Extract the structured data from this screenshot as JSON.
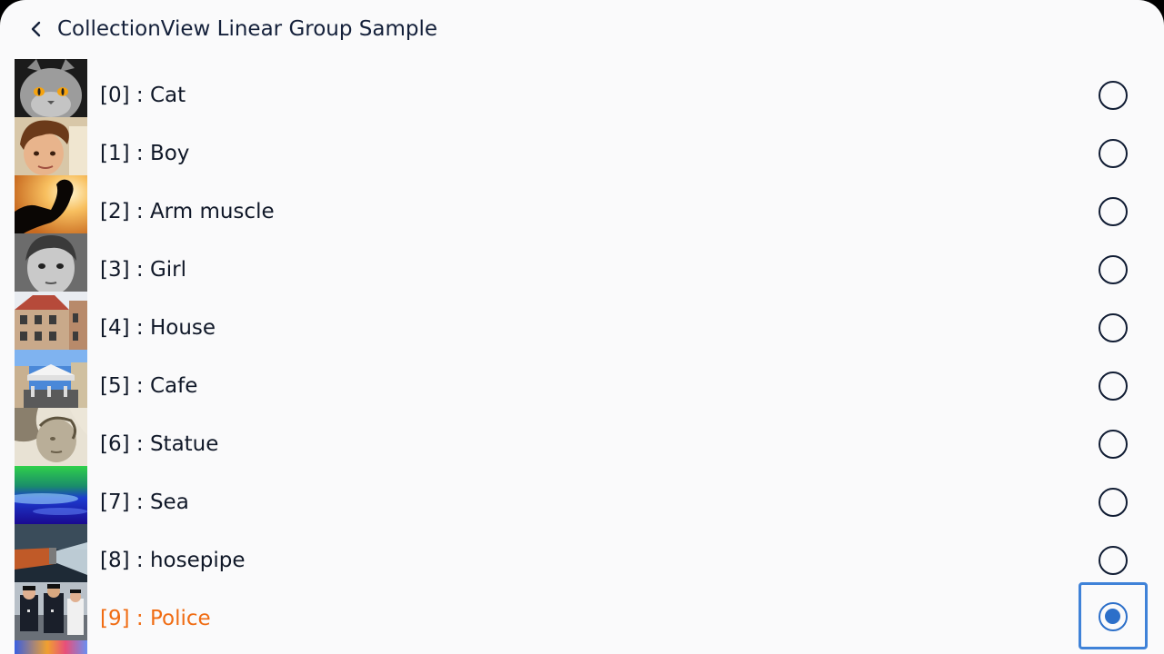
{
  "header": {
    "title": "CollectionView Linear Group Sample",
    "back_icon": "chevron-left-icon"
  },
  "colors": {
    "background": "#fafafb",
    "text": "#101828",
    "selected_text": "#f06c13",
    "radio_selected": "#2c6fc9",
    "focus_border": "#3f82d8"
  },
  "list": {
    "selected_index": 9,
    "items": [
      {
        "label": "[0] : Cat",
        "thumb": "cat-photo",
        "selected": false
      },
      {
        "label": "[1] : Boy",
        "thumb": "boy-photo",
        "selected": false
      },
      {
        "label": "[2] : Arm muscle",
        "thumb": "arm-muscle-photo",
        "selected": false
      },
      {
        "label": "[3] : Girl",
        "thumb": "girl-photo",
        "selected": false
      },
      {
        "label": "[4] : House",
        "thumb": "house-photo",
        "selected": false
      },
      {
        "label": "[5] : Cafe",
        "thumb": "cafe-photo",
        "selected": false
      },
      {
        "label": "[6] : Statue",
        "thumb": "statue-photo",
        "selected": false
      },
      {
        "label": "[7] : Sea",
        "thumb": "sea-photo",
        "selected": false
      },
      {
        "label": "[8] : hosepipe",
        "thumb": "hosepipe-photo",
        "selected": false
      },
      {
        "label": "[9] : Police",
        "thumb": "police-photo",
        "selected": true
      }
    ]
  }
}
